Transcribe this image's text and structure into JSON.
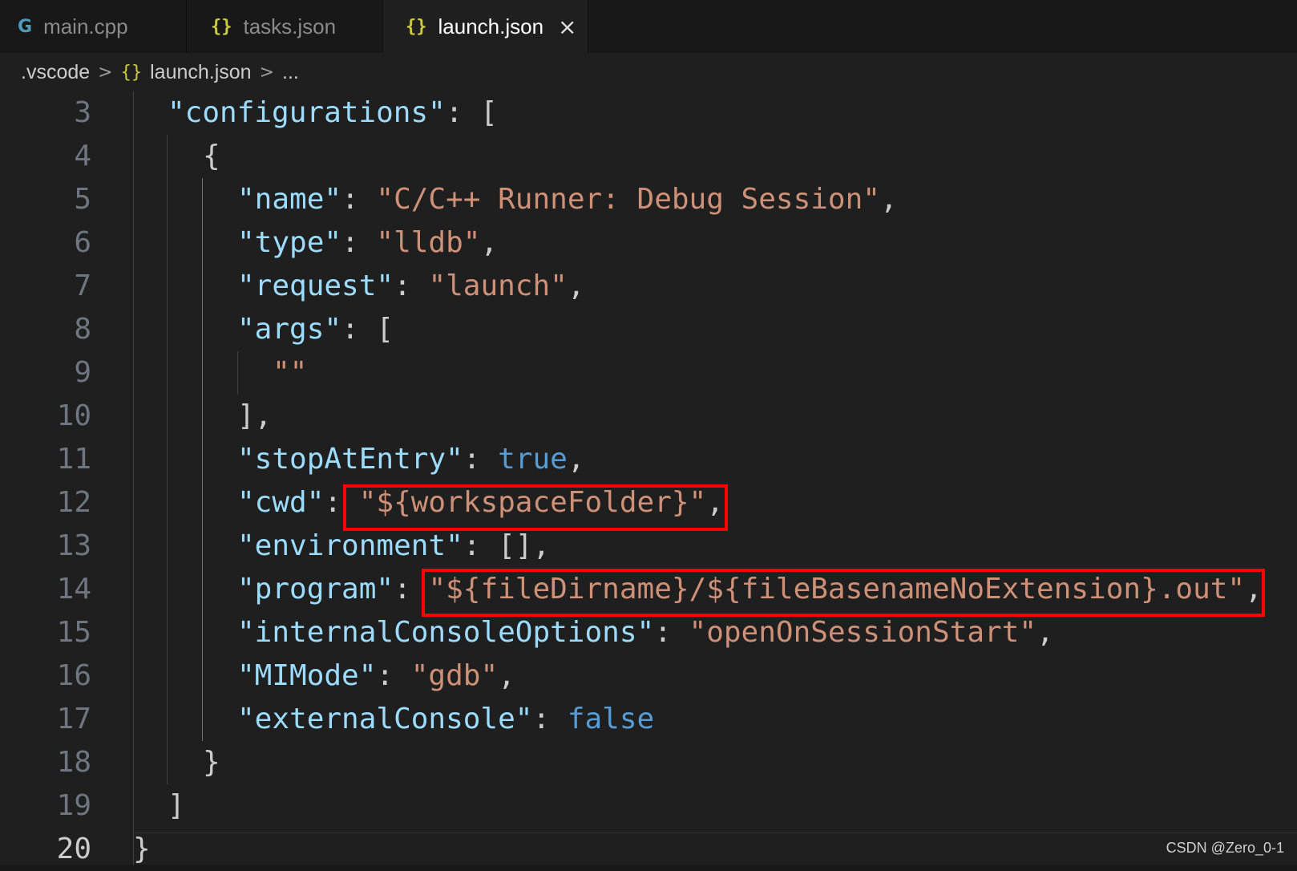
{
  "tabs": [
    {
      "icon": "G",
      "label": "main.cpp"
    },
    {
      "icon": "{}",
      "label": "tasks.json"
    },
    {
      "icon": "{}",
      "label": "launch.json",
      "close": "×"
    }
  ],
  "breadcrumb": {
    "folder": ".vscode",
    "sep": ">",
    "file_icon": "{}",
    "file": "launch.json",
    "more": "..."
  },
  "line_numbers": [
    "3",
    "4",
    "5",
    "6",
    "7",
    "8",
    "9",
    "10",
    "11",
    "12",
    "13",
    "14",
    "15",
    "16",
    "17",
    "18",
    "19",
    "20"
  ],
  "code": {
    "l3_key": "\"configurations\"",
    "l3_rest": ": [",
    "l4": "{",
    "l5_key": "\"name\"",
    "l5_colon": ": ",
    "l5_val": "\"C/C++ Runner: Debug Session\"",
    "l5_end": ",",
    "l6_key": "\"type\"",
    "l6_colon": ": ",
    "l6_val": "\"lldb\"",
    "l6_end": ",",
    "l7_key": "\"request\"",
    "l7_colon": ": ",
    "l7_val": "\"launch\"",
    "l7_end": ",",
    "l8_key": "\"args\"",
    "l8_rest": ": [",
    "l9_val": "\"\"",
    "l10": "],",
    "l11_key": "\"stopAtEntry\"",
    "l11_colon": ": ",
    "l11_val": "true",
    "l11_end": ",",
    "l12_key": "\"cwd\"",
    "l12_colon": ": ",
    "l12_val": "\"${workspaceFolder}\"",
    "l12_end": ",",
    "l13_key": "\"environment\"",
    "l13_rest": ": [],",
    "l14_key": "\"program\"",
    "l14_colon": ": ",
    "l14_val": "\"${fileDirname}/${fileBasenameNoExtension}.out\"",
    "l14_end": ",",
    "l15_key": "\"internalConsoleOptions\"",
    "l15_colon": ": ",
    "l15_val": "\"openOnSessionStart\"",
    "l15_end": ",",
    "l16_key": "\"MIMode\"",
    "l16_colon": ": ",
    "l16_val": "\"gdb\"",
    "l16_end": ",",
    "l17_key": "\"externalConsole\"",
    "l17_colon": ": ",
    "l17_val": "false",
    "l18": "}",
    "l19": "]",
    "l20": "}"
  },
  "watermark": "CSDN @Zero_0-1",
  "colors": {
    "background": "#1f1f1f",
    "json_key": "#9cdcfe",
    "string": "#ce9178",
    "boolean": "#569cd6",
    "highlight_box": "#ff0000"
  }
}
